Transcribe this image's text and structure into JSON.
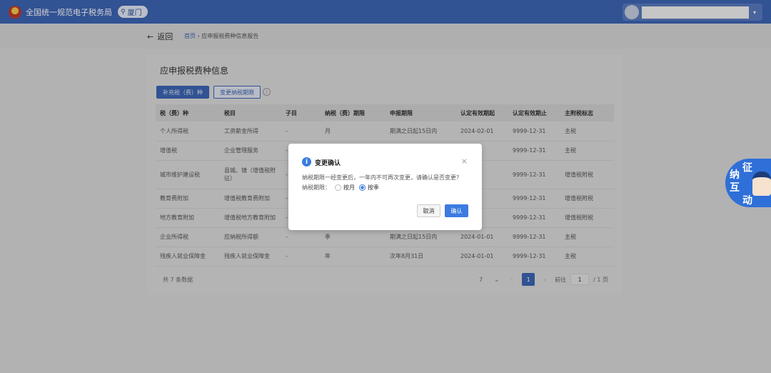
{
  "header": {
    "site_title": "全国统一规范电子税务局",
    "city": "厦门",
    "city_icon": "location-pin-icon",
    "user_name": ""
  },
  "subbar": {
    "back_label": "返回",
    "breadcrumb_home": "首页",
    "breadcrumb_sep": "›",
    "breadcrumb_current": "应申报税费种信息报告"
  },
  "card": {
    "title": "应申报税费种信息",
    "btn_add": "补充税（费）种",
    "btn_change": "变更纳税期限",
    "columns": [
      "税（费）种",
      "税目",
      "子目",
      "纳税（费）期限",
      "申报期限",
      "认定有效期起",
      "认定有效期止",
      "主附税标志"
    ],
    "rows": [
      [
        "个人所得税",
        "工资薪金所得",
        "-",
        "月",
        "期满之日起15日内",
        "2024-02-01",
        "9999-12-31",
        "主税"
      ],
      [
        "增值税",
        "企业管理服务",
        "-",
        "",
        "",
        "01",
        "9999-12-31",
        "主税"
      ],
      [
        "城市维护建设税",
        "县城、镇（增值税附征）",
        "-",
        "",
        "",
        "01",
        "9999-12-31",
        "增值税附税"
      ],
      [
        "教育费附加",
        "增值税教育费附加",
        "-",
        "",
        "",
        "01",
        "9999-12-31",
        "增值税附税"
      ],
      [
        "地方教育附加",
        "增值税地方教育附加",
        "-",
        "",
        "",
        "01",
        "9999-12-31",
        "增值税附税"
      ],
      [
        "企业所得税",
        "应纳税所得额",
        "-",
        "季",
        "期满之日起15日内",
        "2024-01-01",
        "9999-12-31",
        "主税"
      ],
      [
        "残疾人就业保障金",
        "残疾人就业保障金",
        "-",
        "年",
        "次年8月31日",
        "2024-01-01",
        "9999-12-31",
        "主税"
      ]
    ],
    "total": "共 7 条数据",
    "pager": {
      "page_size": "7",
      "current_page": "1",
      "jump_label": "前往",
      "jump_value": "1",
      "total_pages": "/ 1 页"
    }
  },
  "modal": {
    "title": "变更确认",
    "message": "纳税期限一经变更后，一年内不可再次变更，请确认是否变更?",
    "period_label": "纳税期限：",
    "options": [
      "按月",
      "按季"
    ],
    "selected": "按季",
    "cancel_label": "取消",
    "ok_label": "确认",
    "close_icon": "close-icon",
    "info_icon": "info-icon"
  },
  "widget": {
    "chars": [
      "纳",
      "互",
      "征",
      "动"
    ]
  }
}
